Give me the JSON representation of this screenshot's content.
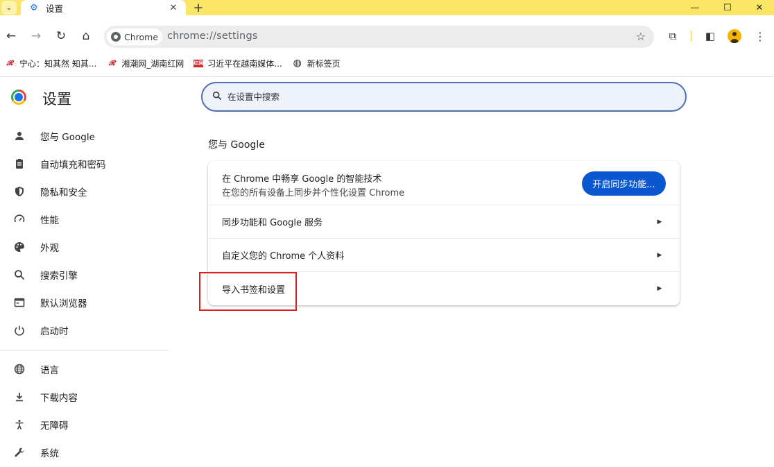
{
  "tab": {
    "title": "设置",
    "close": "✕"
  },
  "tabstrip": {
    "new_tab": "+",
    "search_tabs": "⌄"
  },
  "window": {
    "minimize": "—",
    "maximize": "☐",
    "close": "✕"
  },
  "toolbar": {
    "chip_label": "Chrome",
    "url": "chrome://settings"
  },
  "bookmarks": [
    {
      "label": "宁心：知其然 知其...",
      "icon": "brand-icon"
    },
    {
      "label": "湘潮网_湖南红网",
      "icon": "brand-icon"
    },
    {
      "label": "习近平在越南媒体...",
      "icon": "brand-box-icon",
      "icon_text": "红网"
    },
    {
      "label": "新标签页",
      "icon": "globe-icon"
    }
  ],
  "settings": {
    "title": "设置"
  },
  "nav": {
    "group1": [
      {
        "label": "您与 Google",
        "icon": "person-icon"
      },
      {
        "label": "自动填充和密码",
        "icon": "clipboard-icon"
      },
      {
        "label": "隐私和安全",
        "icon": "shield-icon"
      },
      {
        "label": "性能",
        "icon": "speedometer-icon"
      },
      {
        "label": "外观",
        "icon": "palette-icon"
      },
      {
        "label": "搜索引擎",
        "icon": "search-icon"
      },
      {
        "label": "默认浏览器",
        "icon": "browser-icon"
      },
      {
        "label": "启动时",
        "icon": "power-icon"
      }
    ],
    "group2": [
      {
        "label": "语言",
        "icon": "globe-icon"
      },
      {
        "label": "下载内容",
        "icon": "download-icon"
      },
      {
        "label": "无障碍",
        "icon": "accessibility-icon"
      },
      {
        "label": "系统",
        "icon": "wrench-icon"
      }
    ]
  },
  "search": {
    "placeholder": "在设置中搜索"
  },
  "section": {
    "title": "您与 Google",
    "sync": {
      "line1": "在 Chrome 中畅享 Google 的智能技术",
      "line2": "在您的所有设备上同步并个性化设置 Chrome",
      "button": "开启同步功能..."
    },
    "rows": [
      "同步功能和 Google 服务",
      "自定义您的 Chrome 个人资料",
      "导入书签和设置"
    ]
  },
  "colors": {
    "tabstrip": "#fae566",
    "accent": "#0b57d0",
    "highlight": "#e02020"
  }
}
